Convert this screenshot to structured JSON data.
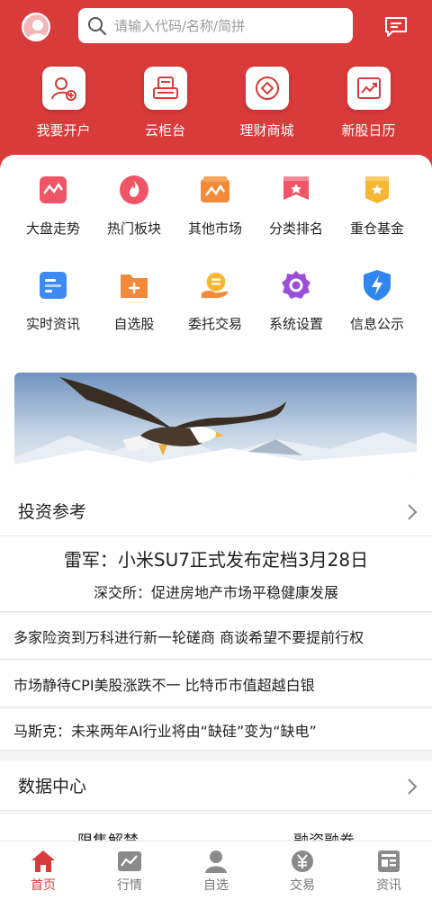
{
  "header": {
    "search_placeholder": "请输入代码/名称/简拼"
  },
  "quick_actions": [
    {
      "label": "我要开户",
      "icon": "user-add-icon"
    },
    {
      "label": "云柜台",
      "icon": "counter-icon"
    },
    {
      "label": "理财商城",
      "icon": "wealth-mall-icon"
    },
    {
      "label": "新股日历",
      "icon": "chart-trend-icon"
    }
  ],
  "grid": [
    {
      "label": "大盘走势",
      "icon": "market-trend-icon"
    },
    {
      "label": "热门板块",
      "icon": "fire-icon"
    },
    {
      "label": "其他市场",
      "icon": "other-market-icon"
    },
    {
      "label": "分类排名",
      "icon": "ranking-icon"
    },
    {
      "label": "重仓基金",
      "icon": "fund-icon"
    },
    {
      "label": "实时资讯",
      "icon": "news-icon"
    },
    {
      "label": "自选股",
      "icon": "add-folder-icon"
    },
    {
      "label": "委托交易",
      "icon": "trade-hand-icon"
    },
    {
      "label": "系统设置",
      "icon": "settings-icon"
    },
    {
      "label": "信息公示",
      "icon": "shield-bolt-icon"
    }
  ],
  "investment": {
    "title": "投资参考",
    "headline": "雷军：小米SU7正式发布定档3月28日",
    "subheadline": "深交所：促进房地产市场平稳健康发展",
    "items": [
      "多家险资到万科进行新一轮磋商 商谈希望不要提前行权",
      "市场静待CPI美股涨跌不一 比特币市值超越白银",
      "马斯克：未来两年AI行业将由“缺硅”变为“缺电”"
    ]
  },
  "data_center": {
    "title": "数据中心",
    "tabs": [
      "限售解禁",
      "融资融券"
    ]
  },
  "tabbar": [
    {
      "label": "首页",
      "icon": "home-icon",
      "active": true
    },
    {
      "label": "行情",
      "icon": "market-chart-icon",
      "active": false
    },
    {
      "label": "自选",
      "icon": "person-icon",
      "active": false
    },
    {
      "label": "交易",
      "icon": "yen-coin-icon",
      "active": false
    },
    {
      "label": "资讯",
      "icon": "newspaper-icon",
      "active": false
    }
  ],
  "colors": {
    "brand": "#d93a3a",
    "background": "#f3f3f3"
  }
}
